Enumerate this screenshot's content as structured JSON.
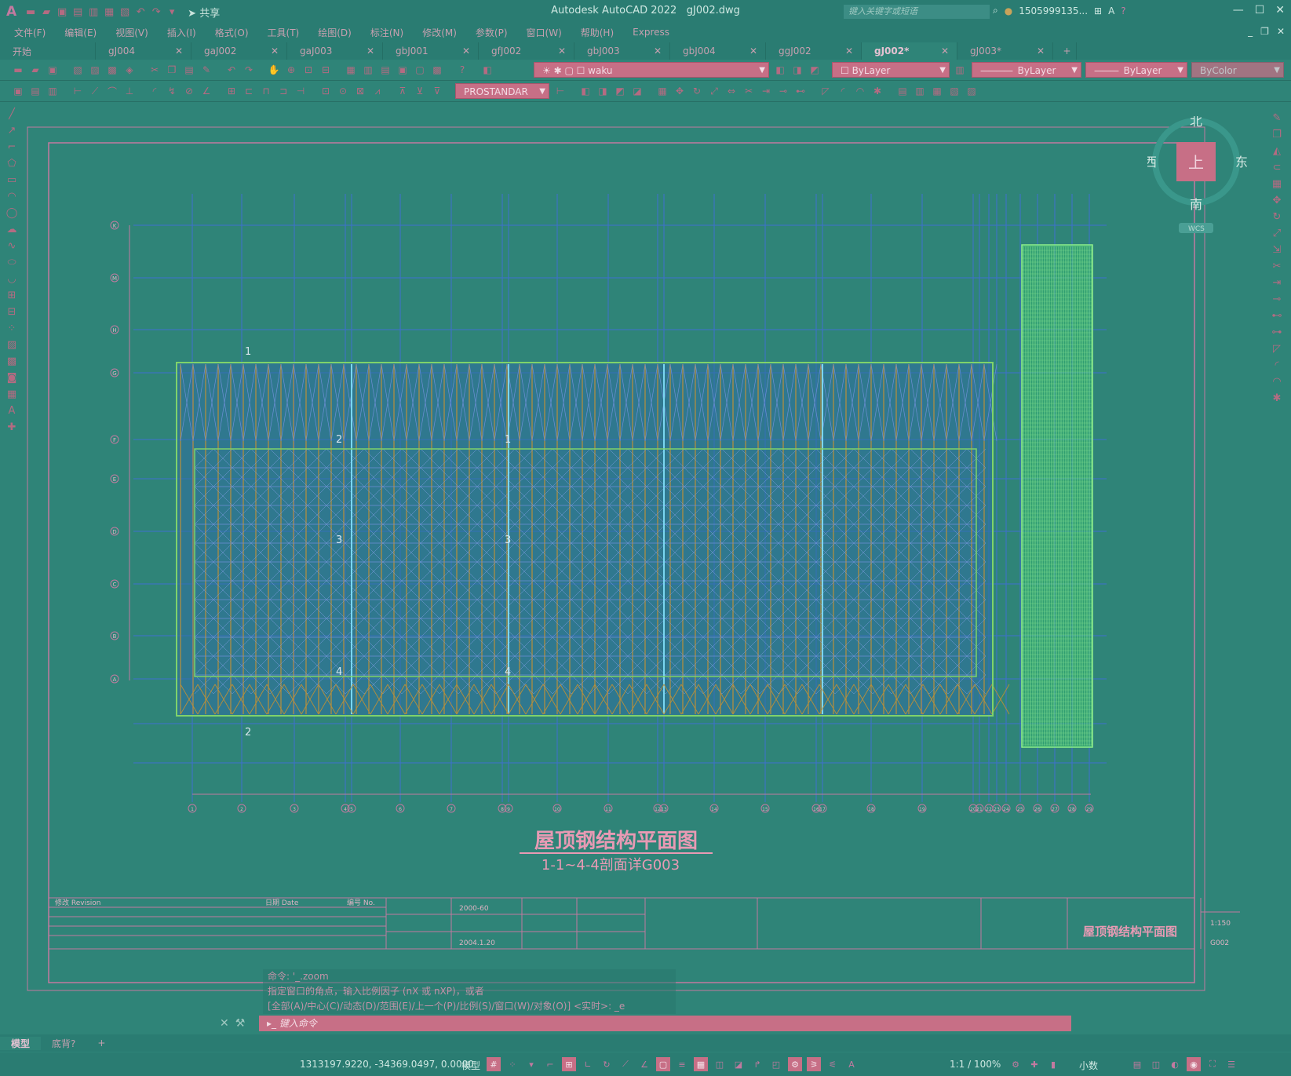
{
  "app": {
    "title": "Autodesk AutoCAD 2022",
    "document": "gJ002.dwg",
    "share_label": "共享",
    "search_placeholder": "键入关键字或短语",
    "user": "1505999135...",
    "colors": {
      "accent": "#c76f86",
      "background": "#2f8478"
    }
  },
  "menu": {
    "items": [
      "文件(F)",
      "编辑(E)",
      "视图(V)",
      "插入(I)",
      "格式(O)",
      "工具(T)",
      "绘图(D)",
      "标注(N)",
      "修改(M)",
      "参数(P)",
      "窗口(W)",
      "帮助(H)",
      "Express"
    ]
  },
  "tabs": [
    {
      "label": "开始"
    },
    {
      "label": "gJ004"
    },
    {
      "label": "gaJ002"
    },
    {
      "label": "gaJ003"
    },
    {
      "label": "gbJ001"
    },
    {
      "label": "gfJ002"
    },
    {
      "label": "gbJ003"
    },
    {
      "label": "gbJ004"
    },
    {
      "label": "ggJ002"
    },
    {
      "label": "gJ002*"
    },
    {
      "label": "gJ003*"
    }
  ],
  "toolbar": {
    "layer_name": "waku",
    "color": "ByLayer",
    "linetype": "ByLayer",
    "lineweight": "ByLayer",
    "plotstyle": "ByColor",
    "dimstyle": "PROSTANDAR"
  },
  "viewcube": {
    "north": "北",
    "south": "南",
    "east": "东",
    "west": "西",
    "top": "上",
    "wcs": "WCS"
  },
  "drawing": {
    "title": "屋顶钢结构平面图",
    "subtitle": "1-1~4-4剖面详G003",
    "grid_rows": [
      "K",
      "M",
      "H",
      "G",
      "F",
      "E",
      "D",
      "C",
      "B",
      "A"
    ],
    "grid_cols": [
      "1",
      "2",
      "3",
      "4",
      "5",
      "6",
      "7",
      "8",
      "9",
      "10",
      "11",
      "12",
      "13",
      "14",
      "15",
      "16",
      "17",
      "18",
      "19",
      "20",
      "21",
      "22",
      "23",
      "24",
      "25",
      "26",
      "27",
      "28",
      "29"
    ],
    "section_marks": [
      "1",
      "2",
      "1",
      "2",
      "3",
      "3",
      "4",
      "4"
    ],
    "title_block": {
      "revision": "修改 Revision",
      "date": "日期 Date",
      "no": "编号 No.",
      "job_no": "2000-60",
      "date_value": "2004.1.20",
      "sheet_title": "屋顶钢结构平面图",
      "scale": "1:150",
      "drawing_no": "G002"
    }
  },
  "command": {
    "history": [
      "命令: '_.zoom",
      "指定窗口的角点，输入比例因子 (nX 或 nXP)，或者",
      "[全部(A)/中心(C)/动态(D)/范围(E)/上一个(P)/比例(S)/窗口(W)/对象(O)] <实时>: _e"
    ],
    "placeholder": "键入命令"
  },
  "layouts": [
    "模型",
    "底背?"
  ],
  "status": {
    "coords": "1313197.9220, -34369.0497, 0.0000",
    "space": "模型",
    "scale": "1:1 / 100%",
    "units": "小数"
  }
}
